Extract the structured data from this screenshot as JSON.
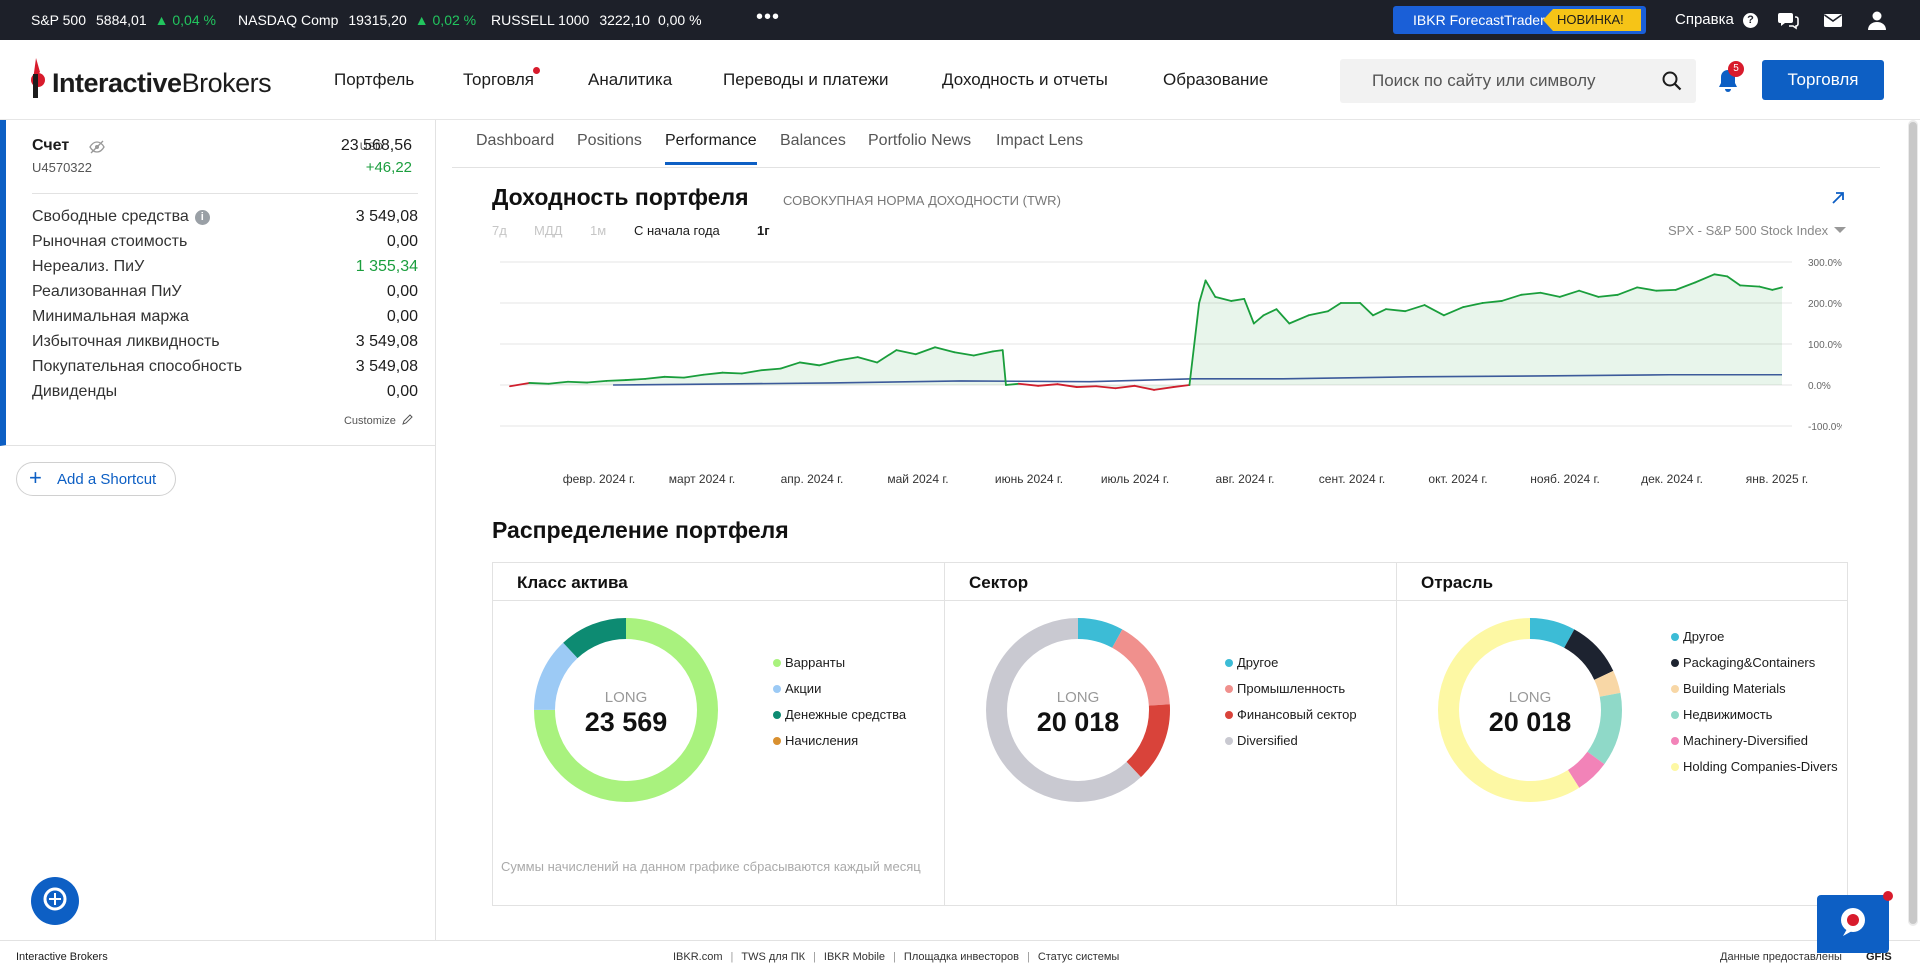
{
  "ticker": [
    {
      "name": "S&P 500",
      "value": "5884,01",
      "change": "▲ 0,04 %",
      "dir": "up"
    },
    {
      "name": "NASDAQ Comp",
      "value": "19315,20",
      "change": "▲ 0,02 %",
      "dir": "up"
    },
    {
      "name": "RUSSELL 1000",
      "value": "3222,10",
      "change": "0,00 %",
      "dir": "flat"
    }
  ],
  "topbar": {
    "more": "•••",
    "forecast_label": "IBKR ForecastTrader",
    "forecast_badge": "НОВИНКА!",
    "help_label": "Справка",
    "icons": [
      "help-icon",
      "chat-icon",
      "mail-icon",
      "user-icon"
    ]
  },
  "header": {
    "logo_bold": "Interactive",
    "logo_rest": "Brokers",
    "nav": [
      "Портфель",
      "Торговля",
      "Аналитика",
      "Переводы и платежи",
      "Доходность и отчеты",
      "Образование"
    ],
    "search_placeholder": "Поиск по сайту или символу",
    "notif_count": "5",
    "trade_button": "Торговля",
    "accent": "#0d5fc4"
  },
  "account": {
    "title": "Счет",
    "id": "U4570322",
    "currency": "USD",
    "value": "23 568,56",
    "change": "+46,22",
    "metrics": [
      {
        "label": "Свободные средства",
        "value": "3 549,08",
        "info": true
      },
      {
        "label": "Рыночная стоимость",
        "value": "0,00"
      },
      {
        "label": "Нереализ. ПиУ",
        "value": "1 355,34",
        "positive": true
      },
      {
        "label": "Реализованная ПиУ",
        "value": "0,00"
      },
      {
        "label": "Минимальная маржа",
        "value": "0,00"
      },
      {
        "label": "Избыточная ликвидность",
        "value": "3 549,08"
      },
      {
        "label": "Покупательная способность",
        "value": "3 549,08"
      },
      {
        "label": "Дивиденды",
        "value": "0,00"
      }
    ],
    "customize": "Customize",
    "add_shortcut": "Add a Shortcut"
  },
  "tabs": [
    "Dashboard",
    "Positions",
    "Performance",
    "Balances",
    "Portfolio News",
    "Impact Lens"
  ],
  "active_tab": "Performance",
  "performance": {
    "title": "Доходность портфеля",
    "subtitle": "СОВОКУПНАЯ НОРМА ДОХОДНОСТИ (TWR)",
    "periods": [
      "7д",
      "МДД",
      "1м",
      "С начала года",
      "1г"
    ],
    "active_period": "1г",
    "benchmark": "SPX - S&P 500 Stock Index"
  },
  "chart_data": {
    "type": "line",
    "x_ticks": [
      "февр. 2024 г.",
      "март 2024 г.",
      "апр. 2024 г.",
      "май 2024 г.",
      "июнь 2024 г.",
      "июль 2024 г.",
      "авг. 2024 г.",
      "сент. 2024 г.",
      "окт. 2024 г.",
      "нояб. 2024 г.",
      "дек. 2024 г.",
      "янв. 2025 г."
    ],
    "y_ticks": [
      "300.0%",
      "200.0%",
      "100.0%",
      "0.0%",
      "-100.0%"
    ],
    "ylim": [
      -100,
      300
    ],
    "x_range": [
      0,
      13
    ],
    "grid": true,
    "series": [
      {
        "color": "#1a9e3c",
        "fill": "#1a9e3c",
        "points": [
          [
            0,
            -3
          ],
          [
            0.3,
            5
          ],
          [
            0.6,
            3
          ],
          [
            0.9,
            8
          ],
          [
            1.2,
            6
          ],
          [
            1.5,
            10
          ],
          [
            1.8,
            12
          ],
          [
            2.1,
            15
          ],
          [
            2.4,
            20
          ],
          [
            2.7,
            18
          ],
          [
            3.0,
            25
          ],
          [
            3.3,
            30
          ],
          [
            3.6,
            28
          ],
          [
            3.9,
            36
          ],
          [
            4.2,
            40
          ],
          [
            4.5,
            55
          ],
          [
            4.8,
            48
          ],
          [
            5.1,
            60
          ],
          [
            5.4,
            68
          ],
          [
            5.7,
            55
          ],
          [
            6.0,
            85
          ],
          [
            6.3,
            75
          ],
          [
            6.6,
            92
          ],
          [
            6.9,
            80
          ],
          [
            7.2,
            72
          ],
          [
            7.5,
            82
          ],
          [
            7.65,
            85
          ],
          [
            7.7,
            0
          ],
          [
            7.9,
            3
          ],
          [
            8.2,
            -2
          ],
          [
            8.5,
            2
          ],
          [
            8.8,
            -5
          ],
          [
            9.1,
            -3
          ],
          [
            9.4,
            -8
          ],
          [
            9.7,
            -2
          ],
          [
            10.0,
            -12
          ],
          [
            10.3,
            -5
          ],
          [
            10.55,
            0
          ],
          [
            10.7,
            200
          ],
          [
            10.8,
            255
          ],
          [
            10.95,
            215
          ],
          [
            11.2,
            205
          ],
          [
            11.4,
            210
          ],
          [
            11.55,
            150
          ],
          [
            11.7,
            170
          ],
          [
            11.9,
            185
          ],
          [
            12.1,
            150
          ],
          [
            12.4,
            170
          ],
          [
            12.7,
            180
          ],
          [
            12.9,
            200
          ],
          [
            13.2,
            200
          ],
          [
            13.4,
            170
          ],
          [
            13.6,
            185
          ],
          [
            13.9,
            180
          ],
          [
            14.2,
            195
          ],
          [
            14.5,
            170
          ],
          [
            14.8,
            190
          ],
          [
            15.1,
            200
          ],
          [
            15.4,
            205
          ],
          [
            15.7,
            220
          ],
          [
            16.0,
            225
          ],
          [
            16.3,
            215
          ],
          [
            16.6,
            230
          ],
          [
            16.9,
            215
          ],
          [
            17.2,
            220
          ],
          [
            17.5,
            238
          ],
          [
            17.8,
            230
          ],
          [
            18.1,
            232
          ],
          [
            18.4,
            250
          ],
          [
            18.7,
            270
          ],
          [
            18.9,
            265
          ],
          [
            19.1,
            243
          ],
          [
            19.4,
            240
          ],
          [
            19.6,
            232
          ],
          [
            19.75,
            238
          ]
        ]
      },
      {
        "color": "#3c5a9a",
        "points": [
          [
            1.6,
            0
          ],
          [
            3,
            2
          ],
          [
            5,
            5
          ],
          [
            7,
            10
          ],
          [
            9,
            8
          ],
          [
            10.6,
            15
          ],
          [
            12,
            15
          ],
          [
            14,
            20
          ],
          [
            16,
            22
          ],
          [
            18,
            25
          ],
          [
            19.75,
            25
          ]
        ]
      }
    ],
    "negative_color": "#d01f2e"
  },
  "allocation": {
    "title": "Распределение портфеля",
    "note": "Суммы начислений на данном графике сбрасываются каждый месяц",
    "panels": [
      {
        "title": "Класс актива",
        "center_label": "LONG",
        "center_value": "23 569",
        "slices": [
          {
            "label": "Варранты",
            "value": 75,
            "color": "#a9f27e"
          },
          {
            "label": "Акции",
            "value": 13,
            "color": "#9ccaf5"
          },
          {
            "label": "Денежные средства",
            "value": 12,
            "color": "#0d8b72"
          },
          {
            "label": "Начисления",
            "value": 0,
            "color": "#d9902f"
          }
        ],
        "start_fraction": 0
      },
      {
        "title": "Сектор",
        "center_label": "LONG",
        "center_value": "20 018",
        "slices": [
          {
            "label": "Другое",
            "value": 8,
            "color": "#3cbcd6"
          },
          {
            "label": "Промышленность",
            "value": 16,
            "color": "#f0908d"
          },
          {
            "label": "Финансовый сектор",
            "value": 14,
            "color": "#d9433a"
          },
          {
            "label": "Diversified",
            "value": 62,
            "color": "#c9c9d1"
          }
        ],
        "start_fraction": 0
      },
      {
        "title": "Отрасль",
        "center_label": "LONG",
        "center_value": "20 018",
        "slices": [
          {
            "label": "Другое",
            "value": 8,
            "color": "#3cbcd6"
          },
          {
            "label": "Packaging&Containers",
            "value": 10,
            "color": "#1d2330"
          },
          {
            "label": "Building Materials",
            "value": 4,
            "color": "#f8d7a6"
          },
          {
            "label": "Недвижимость",
            "value": 13,
            "color": "#8fd9c8"
          },
          {
            "label": "Machinery-Diversified",
            "value": 6,
            "color": "#f283b8"
          },
          {
            "label": "Holding Companies-Divers",
            "value": 59,
            "color": "#fdf8a4"
          }
        ],
        "start_fraction": 0
      }
    ]
  },
  "footer": {
    "brand": "Interactive Brokers",
    "links": [
      "IBKR.com",
      "TWS для ПК",
      "IBKR Mobile",
      "Площадка инвесторов",
      "Статус системы"
    ],
    "data_by": "Данные предоставлены",
    "gfis": "GFIS"
  }
}
